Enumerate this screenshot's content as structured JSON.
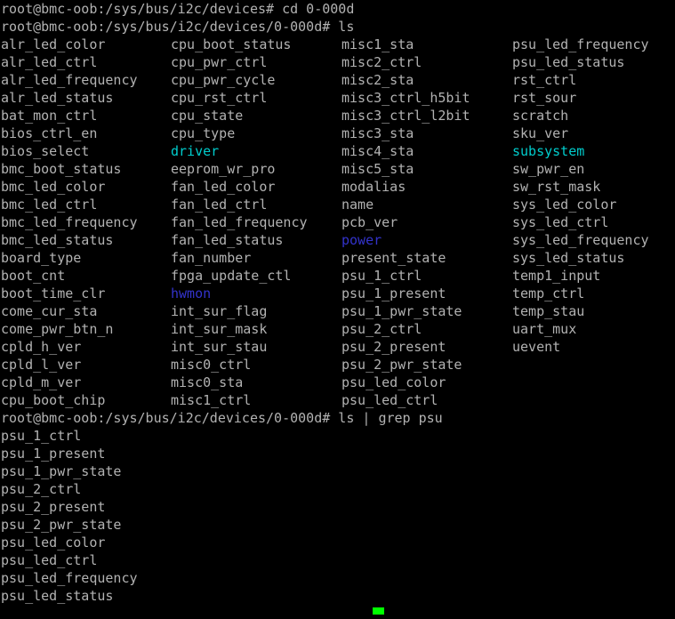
{
  "terminal": {
    "title": "root@bmc-oob terminal",
    "colors": {
      "background": "#000000",
      "foreground": "#b2b2b2",
      "directory": "#3333cc",
      "symlink": "#00cdcd",
      "cursor": "#00ff00"
    },
    "command_1": {
      "prompt": "root@bmc-oob:/sys/bus/i2c/devices# ",
      "command": "cd 0-000d",
      "full": "root@bmc-oob:/sys/bus/i2c/devices# cd 0-000d"
    },
    "command_2": {
      "prompt": "root@bmc-oob:/sys/bus/i2c/devices/0-000d# ",
      "command": "ls",
      "full": "root@bmc-oob:/sys/bus/i2c/devices/0-000d# ls"
    },
    "command_3": {
      "prompt": "root@bmc-oob:/sys/bus/i2c/devices/0-000d# ",
      "command": "ls | grep psu",
      "full": "root@bmc-oob:/sys/bus/i2c/devices/0-000d# ls | grep psu"
    },
    "ls_output": {
      "rows": [
        [
          {
            "name": "alr_led_color",
            "type": "file"
          },
          {
            "name": "cpu_boot_status",
            "type": "file"
          },
          {
            "name": "misc1_sta",
            "type": "file"
          },
          {
            "name": "psu_led_frequency",
            "type": "file"
          }
        ],
        [
          {
            "name": "alr_led_ctrl",
            "type": "file"
          },
          {
            "name": "cpu_pwr_ctrl",
            "type": "file"
          },
          {
            "name": "misc2_ctrl",
            "type": "file"
          },
          {
            "name": "psu_led_status",
            "type": "file"
          }
        ],
        [
          {
            "name": "alr_led_frequency",
            "type": "file"
          },
          {
            "name": "cpu_pwr_cycle",
            "type": "file"
          },
          {
            "name": "misc2_sta",
            "type": "file"
          },
          {
            "name": "rst_ctrl",
            "type": "file"
          }
        ],
        [
          {
            "name": "alr_led_status",
            "type": "file"
          },
          {
            "name": "cpu_rst_ctrl",
            "type": "file"
          },
          {
            "name": "misc3_ctrl_h5bit",
            "type": "file"
          },
          {
            "name": "rst_sour",
            "type": "file"
          }
        ],
        [
          {
            "name": "bat_mon_ctrl",
            "type": "file"
          },
          {
            "name": "cpu_state",
            "type": "file"
          },
          {
            "name": "misc3_ctrl_l2bit",
            "type": "file"
          },
          {
            "name": "scratch",
            "type": "file"
          }
        ],
        [
          {
            "name": "bios_ctrl_en",
            "type": "file"
          },
          {
            "name": "cpu_type",
            "type": "file"
          },
          {
            "name": "misc3_sta",
            "type": "file"
          },
          {
            "name": "sku_ver",
            "type": "file"
          }
        ],
        [
          {
            "name": "bios_select",
            "type": "file"
          },
          {
            "name": "driver",
            "type": "link"
          },
          {
            "name": "misc4_sta",
            "type": "file"
          },
          {
            "name": "subsystem",
            "type": "link"
          }
        ],
        [
          {
            "name": "bmc_boot_status",
            "type": "file"
          },
          {
            "name": "eeprom_wr_pro",
            "type": "file"
          },
          {
            "name": "misc5_sta",
            "type": "file"
          },
          {
            "name": "sw_pwr_en",
            "type": "file"
          }
        ],
        [
          {
            "name": "bmc_led_color",
            "type": "file"
          },
          {
            "name": "fan_led_color",
            "type": "file"
          },
          {
            "name": "modalias",
            "type": "file"
          },
          {
            "name": "sw_rst_mask",
            "type": "file"
          }
        ],
        [
          {
            "name": "bmc_led_ctrl",
            "type": "file"
          },
          {
            "name": "fan_led_ctrl",
            "type": "file"
          },
          {
            "name": "name",
            "type": "file"
          },
          {
            "name": "sys_led_color",
            "type": "file"
          }
        ],
        [
          {
            "name": "bmc_led_frequency",
            "type": "file"
          },
          {
            "name": "fan_led_frequency",
            "type": "file"
          },
          {
            "name": "pcb_ver",
            "type": "file"
          },
          {
            "name": "sys_led_ctrl",
            "type": "file"
          }
        ],
        [
          {
            "name": "bmc_led_status",
            "type": "file"
          },
          {
            "name": "fan_led_status",
            "type": "file"
          },
          {
            "name": "power",
            "type": "dir"
          },
          {
            "name": "sys_led_frequency",
            "type": "file"
          }
        ],
        [
          {
            "name": "board_type",
            "type": "file"
          },
          {
            "name": "fan_number",
            "type": "file"
          },
          {
            "name": "present_state",
            "type": "file"
          },
          {
            "name": "sys_led_status",
            "type": "file"
          }
        ],
        [
          {
            "name": "boot_cnt",
            "type": "file"
          },
          {
            "name": "fpga_update_ctl",
            "type": "file"
          },
          {
            "name": "psu_1_ctrl",
            "type": "file"
          },
          {
            "name": "temp1_input",
            "type": "file"
          }
        ],
        [
          {
            "name": "boot_time_clr",
            "type": "file"
          },
          {
            "name": "hwmon",
            "type": "dir"
          },
          {
            "name": "psu_1_present",
            "type": "file"
          },
          {
            "name": "temp_ctrl",
            "type": "file"
          }
        ],
        [
          {
            "name": "come_cur_sta",
            "type": "file"
          },
          {
            "name": "int_sur_flag",
            "type": "file"
          },
          {
            "name": "psu_1_pwr_state",
            "type": "file"
          },
          {
            "name": "temp_stau",
            "type": "file"
          }
        ],
        [
          {
            "name": "come_pwr_btn_n",
            "type": "file"
          },
          {
            "name": "int_sur_mask",
            "type": "file"
          },
          {
            "name": "psu_2_ctrl",
            "type": "file"
          },
          {
            "name": "uart_mux",
            "type": "file"
          }
        ],
        [
          {
            "name": "cpld_h_ver",
            "type": "file"
          },
          {
            "name": "int_sur_stau",
            "type": "file"
          },
          {
            "name": "psu_2_present",
            "type": "file"
          },
          {
            "name": "uevent",
            "type": "file"
          }
        ],
        [
          {
            "name": "cpld_l_ver",
            "type": "file"
          },
          {
            "name": "misc0_ctrl",
            "type": "file"
          },
          {
            "name": "psu_2_pwr_state",
            "type": "file"
          },
          {
            "name": "",
            "type": "file"
          }
        ],
        [
          {
            "name": "cpld_m_ver",
            "type": "file"
          },
          {
            "name": "misc0_sta",
            "type": "file"
          },
          {
            "name": "psu_led_color",
            "type": "file"
          },
          {
            "name": "",
            "type": "file"
          }
        ],
        [
          {
            "name": "cpu_boot_chip",
            "type": "file"
          },
          {
            "name": "misc1_ctrl",
            "type": "file"
          },
          {
            "name": "psu_led_ctrl",
            "type": "file"
          },
          {
            "name": "",
            "type": "file"
          }
        ]
      ]
    },
    "grep_output": {
      "lines": [
        "psu_1_ctrl",
        "psu_1_present",
        "psu_1_pwr_state",
        "psu_2_ctrl",
        "psu_2_present",
        "psu_2_pwr_state",
        "psu_led_color",
        "psu_led_ctrl",
        "psu_led_frequency",
        "psu_led_status"
      ]
    }
  }
}
